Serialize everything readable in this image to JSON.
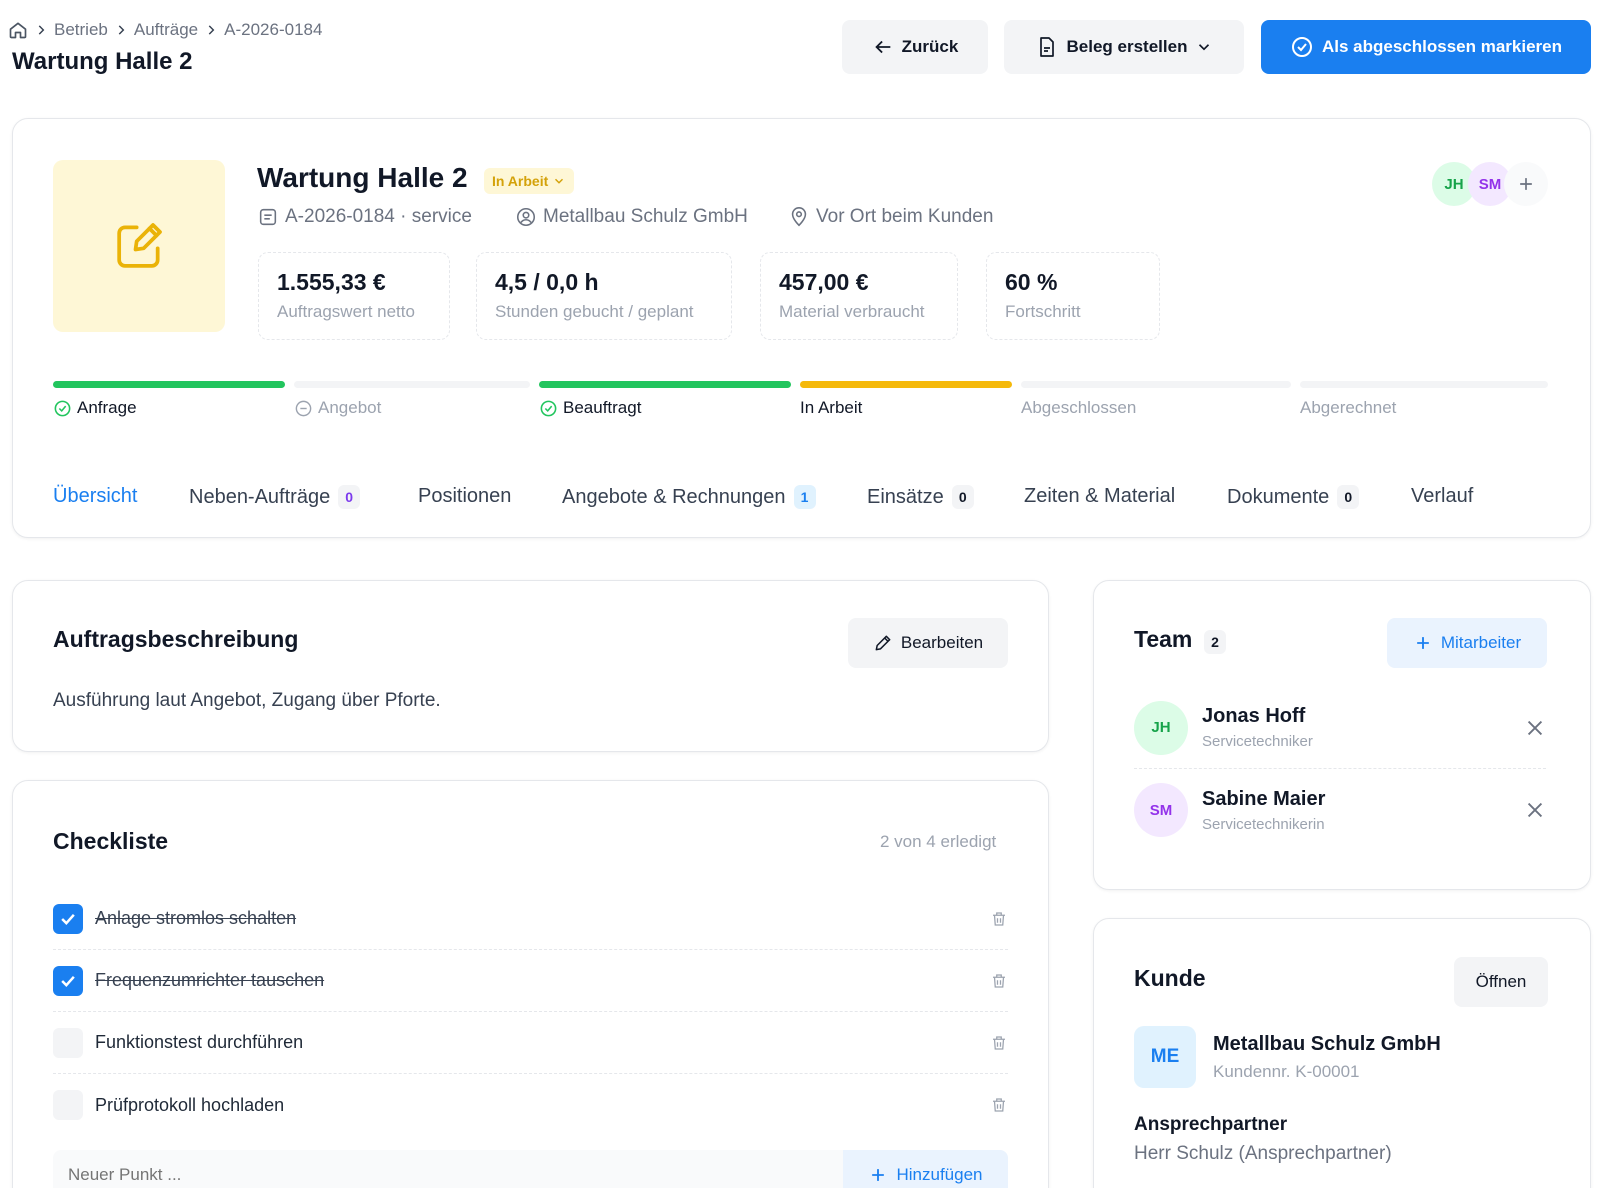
{
  "colors": {
    "primary": "#1a7ff0",
    "success": "#22c55e",
    "warning": "#f5b90b",
    "muted": "#9ca3af"
  },
  "breadcrumb": {
    "items": [
      "Betrieb",
      "Aufträge",
      "A-2026-0184"
    ]
  },
  "page": {
    "title": "Wartung Halle 2"
  },
  "header_actions": {
    "back": "Zurück",
    "create_document": "Beleg erstellen",
    "mark_done": "Als abgeschlossen markieren"
  },
  "job": {
    "title": "Wartung Halle 2",
    "status": "In Arbeit",
    "number_type": "A-2026-0184 · service",
    "customer": "Metallbau Schulz GmbH",
    "location": "Vor Ort beim Kunden",
    "assignees": [
      "JH",
      "SM"
    ],
    "stats": [
      {
        "value": "1.555,33 €",
        "label": "Auftragswert netto"
      },
      {
        "value": "4,5 / 0,0 h",
        "label": "Stunden gebucht / geplant"
      },
      {
        "value": "457,00 €",
        "label": "Material verbraucht"
      },
      {
        "value": "60 %",
        "label": "Fortschritt"
      }
    ]
  },
  "pipeline": [
    {
      "label": "Anfrage",
      "state": "done"
    },
    {
      "label": "Angebot",
      "state": "skipped"
    },
    {
      "label": "Beauftragt",
      "state": "done"
    },
    {
      "label": "In Arbeit",
      "state": "current"
    },
    {
      "label": "Abgeschlossen",
      "state": "pending"
    },
    {
      "label": "Abgerechnet",
      "state": "pending"
    }
  ],
  "tabs": [
    {
      "label": "Übersicht",
      "count": null
    },
    {
      "label": "Neben-Aufträge",
      "count": "0"
    },
    {
      "label": "Positionen",
      "count": null
    },
    {
      "label": "Angebote & Rechnungen",
      "count": "1"
    },
    {
      "label": "Einsätze",
      "count": "0"
    },
    {
      "label": "Zeiten & Material",
      "count": null
    },
    {
      "label": "Dokumente",
      "count": "0"
    },
    {
      "label": "Verlauf",
      "count": null
    }
  ],
  "description": {
    "title": "Auftragsbeschreibung",
    "edit_label": "Bearbeiten",
    "text": "Ausführung laut Angebot, Zugang über Pforte."
  },
  "checklist": {
    "title": "Checkliste",
    "summary": "2 von 4 erledigt",
    "items": [
      {
        "label": "Anlage stromlos schalten",
        "done": true
      },
      {
        "label": "Frequenzumrichter tauschen",
        "done": true
      },
      {
        "label": "Funktionstest durchführen",
        "done": false
      },
      {
        "label": "Prüfprotokoll hochladen",
        "done": false
      }
    ],
    "new_placeholder": "Neuer Punkt ...",
    "add_label": "Hinzufügen"
  },
  "team": {
    "title": "Team",
    "count": "2",
    "add_label": "Mitarbeiter",
    "members": [
      {
        "initials": "JH",
        "name": "Jonas Hoff",
        "role": "Servicetechniker"
      },
      {
        "initials": "SM",
        "name": "Sabine Maier",
        "role": "Servicetechnikerin"
      }
    ]
  },
  "customer_card": {
    "title": "Kunde",
    "open_label": "Öffnen",
    "initials": "ME",
    "name": "Metallbau Schulz GmbH",
    "number": "Kundennr. K-00001",
    "contact_title": "Ansprechpartner",
    "contact_name": "Herr Schulz (Ansprechpartner)"
  }
}
